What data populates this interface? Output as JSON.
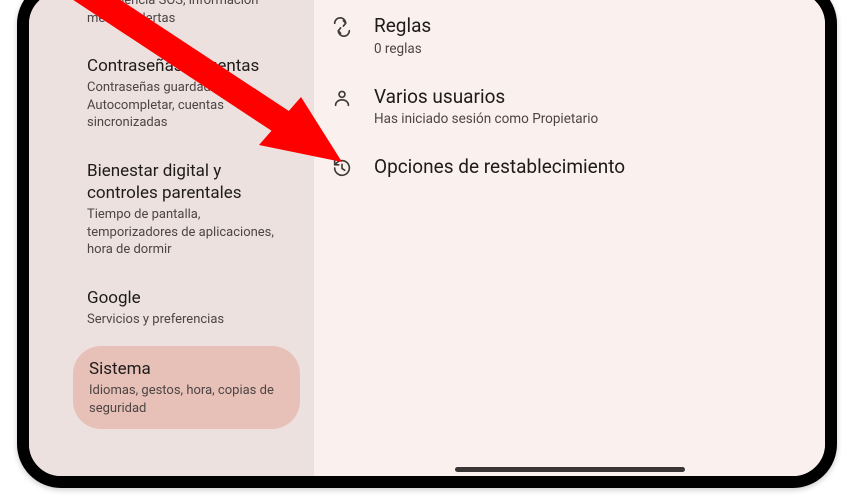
{
  "sidebar": {
    "items": [
      {
        "title": "",
        "sub": "Emergencia SOS, información médica, alertas"
      },
      {
        "title": "Contraseñas y cuentas",
        "sub": "Contraseñas guardadas, Autocompletar, cuentas sincronizadas"
      },
      {
        "title": "Bienestar digital y controles parentales",
        "sub": "Tiempo de pantalla, temporizadores de aplicaciones, hora de dormir"
      },
      {
        "title": "Google",
        "sub": "Servicios y preferencias"
      },
      {
        "title": "Sistema",
        "sub": "Idiomas, gestos, hora, copias de seguridad"
      }
    ]
  },
  "main": {
    "rows": [
      {
        "title": "Reglas",
        "sub": "0 reglas"
      },
      {
        "title": "Varios usuarios",
        "sub": "Has iniciado sesión como Propietario"
      },
      {
        "title": "Opciones de restablecimiento",
        "sub": ""
      }
    ]
  }
}
